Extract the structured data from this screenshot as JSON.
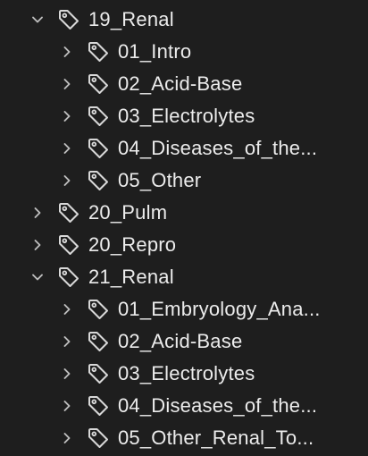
{
  "tree": {
    "groups": [
      {
        "label": "19_Renal",
        "expanded": true,
        "icon": "tag-icon",
        "children": [
          {
            "label": "01_Intro",
            "icon": "tag-icon"
          },
          {
            "label": "02_Acid-Base",
            "icon": "tag-icon"
          },
          {
            "label": "03_Electrolytes",
            "icon": "tag-icon"
          },
          {
            "label": "04_Diseases_of_the...",
            "icon": "tag-icon"
          },
          {
            "label": "05_Other",
            "icon": "tag-icon"
          }
        ]
      },
      {
        "label": "20_Pulm",
        "expanded": false,
        "icon": "tag-icon"
      },
      {
        "label": "20_Repro",
        "expanded": false,
        "icon": "tag-icon"
      },
      {
        "label": "21_Renal",
        "expanded": true,
        "icon": "tag-icon",
        "children": [
          {
            "label": "01_Embryology_Ana...",
            "icon": "tag-icon"
          },
          {
            "label": "02_Acid-Base",
            "icon": "tag-icon"
          },
          {
            "label": "03_Electrolytes",
            "icon": "tag-icon"
          },
          {
            "label": "04_Diseases_of_the...",
            "icon": "tag-icon"
          },
          {
            "label": "05_Other_Renal_To...",
            "icon": "tag-icon"
          }
        ]
      }
    ]
  },
  "colors": {
    "background": "#1e1e1e",
    "text": "#ececec",
    "icon": "#d8d8d8",
    "chevron": "#bdbdbd"
  }
}
